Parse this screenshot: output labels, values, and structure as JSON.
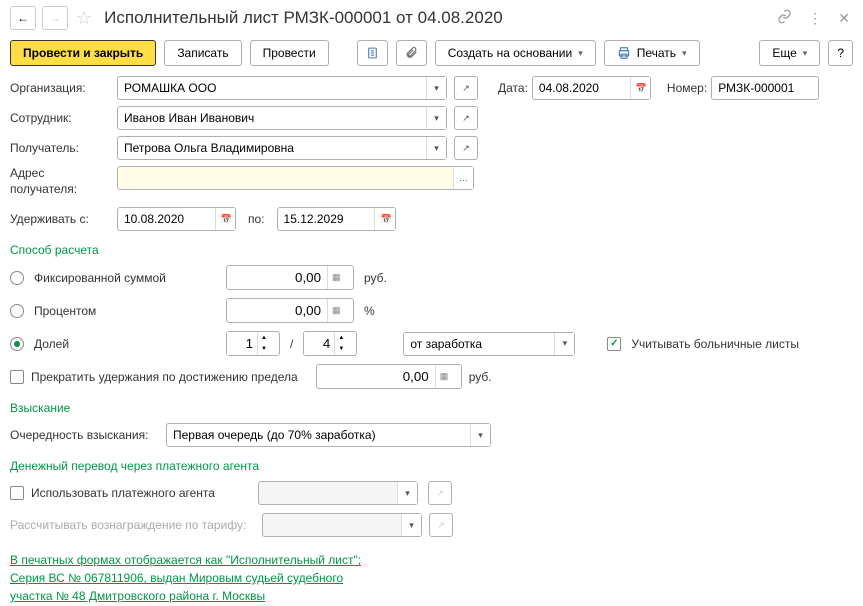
{
  "header": {
    "title": "Исполнительный лист РМЗК-000001 от 04.08.2020"
  },
  "toolbar": {
    "submit_close": "Провести и закрыть",
    "save": "Записать",
    "submit": "Провести",
    "create_based": "Создать на основании",
    "print": "Печать",
    "more": "Еще",
    "help": "?"
  },
  "fields": {
    "org_label": "Организация:",
    "org_value": "РОМАШКА ООО",
    "date_label": "Дата:",
    "date_value": "04.08.2020",
    "number_label": "Номер:",
    "number_value": "РМЗК-000001",
    "employee_label": "Сотрудник:",
    "employee_value": "Иванов Иван Иванович",
    "recipient_label": "Получатель:",
    "recipient_value": "Петрова Ольга Владимировна",
    "recipient_addr_label": "Адрес получателя:",
    "recipient_addr_value": "",
    "withhold_from_label": "Удерживать с:",
    "withhold_from_value": "10.08.2020",
    "to_label": "по:",
    "withhold_to_value": "15.12.2029"
  },
  "calc": {
    "title": "Способ расчета",
    "fixed_label": "Фиксированной суммой",
    "fixed_value": "0,00",
    "fixed_unit": "руб.",
    "percent_label": "Процентом",
    "percent_value": "0,00",
    "percent_unit": "%",
    "fraction_label": "Долей",
    "fraction_num": "1",
    "fraction_den": "4",
    "fraction_base": "от заработка",
    "sick_leave_label": "Учитывать больничные листы",
    "stop_label": "Прекратить удержания по достижению предела",
    "stop_value": "0,00",
    "stop_unit": "руб."
  },
  "recovery": {
    "title": "Взыскание",
    "priority_label": "Очередность взыскания:",
    "priority_value": "Первая очередь (до 70% заработка)"
  },
  "agent": {
    "title": "Денежный перевод через платежного агента",
    "use_agent_label": "Использовать платежного агента",
    "tariff_label": "Рассчитывать вознаграждение по тарифу:"
  },
  "footer": {
    "link_text": "В печатных формах отображается как \"Исполнительный лист\"; Серия ВС № 067811906, выдан Мировым судьей судебного участка № 48 Дмитровского района г. Москвы"
  }
}
